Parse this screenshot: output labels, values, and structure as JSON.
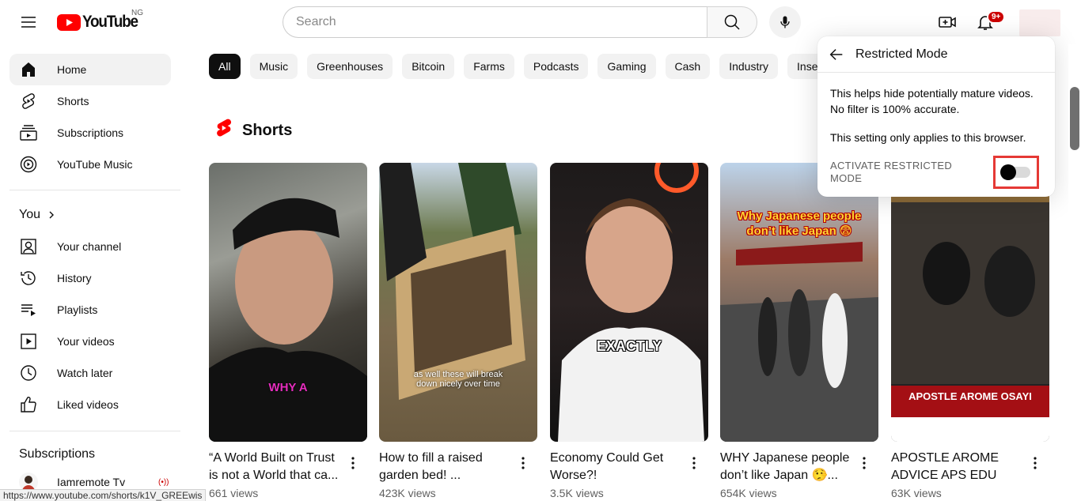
{
  "header": {
    "logo_text": "YouTube",
    "region": "NG",
    "search_placeholder": "Search",
    "notification_count": "9+"
  },
  "sidebar": {
    "main": [
      {
        "label": "Home",
        "icon": "home-icon",
        "active": true
      },
      {
        "label": "Shorts",
        "icon": "shorts-icon"
      },
      {
        "label": "Subscriptions",
        "icon": "subscriptions-icon"
      },
      {
        "label": "YouTube Music",
        "icon": "youtube-music-icon"
      }
    ],
    "you_title": "You",
    "you": [
      {
        "label": "Your channel",
        "icon": "your-channel-icon"
      },
      {
        "label": "History",
        "icon": "history-icon"
      },
      {
        "label": "Playlists",
        "icon": "playlists-icon"
      },
      {
        "label": "Your videos",
        "icon": "your-videos-icon"
      },
      {
        "label": "Watch later",
        "icon": "watch-later-icon"
      },
      {
        "label": "Liked videos",
        "icon": "liked-videos-icon"
      }
    ],
    "subscriptions_title": "Subscriptions",
    "subscriptions": [
      {
        "label": "Iamremote Tv",
        "live": "(•))"
      }
    ]
  },
  "chips": [
    "All",
    "Music",
    "Greenhouses",
    "Bitcoin",
    "Farms",
    "Podcasts",
    "Gaming",
    "Cash",
    "Industry",
    "Inse"
  ],
  "shorts": {
    "title": "Shorts",
    "items": [
      {
        "title": "“A World Built on Trust is not a World that ca...",
        "views": "661 views",
        "overlay": "WHY A"
      },
      {
        "title": "How to fill a raised garden bed! ...",
        "views": "423K views",
        "overlay": "as well these will break down nicely over time"
      },
      {
        "title": "Economy Could Get Worse?!",
        "views": "3.5K views",
        "overlay": "EXACTLY"
      },
      {
        "title": "WHY Japanese people don’t like Japan 🤥...",
        "views": "654K views",
        "overlay": "Why Japanese people don’t like Japan 😨"
      },
      {
        "title": "APOSTLE AROME ADVICE APS EDU",
        "views": "63K views",
        "overlay": "APOSTLE AROME OSAYI"
      }
    ]
  },
  "restricted_mode": {
    "title": "Restricted Mode",
    "desc1": "This helps hide potentially mature videos. No filter is 100% accurate.",
    "desc2": "This setting only applies to this browser.",
    "activate_label": "ACTIVATE RESTRICTED MODE",
    "enabled": false
  },
  "status_url": "https://www.youtube.com/shorts/k1V_GREEwis",
  "colors": {
    "brand_red": "#ff0000",
    "highlight": "#e53935"
  }
}
